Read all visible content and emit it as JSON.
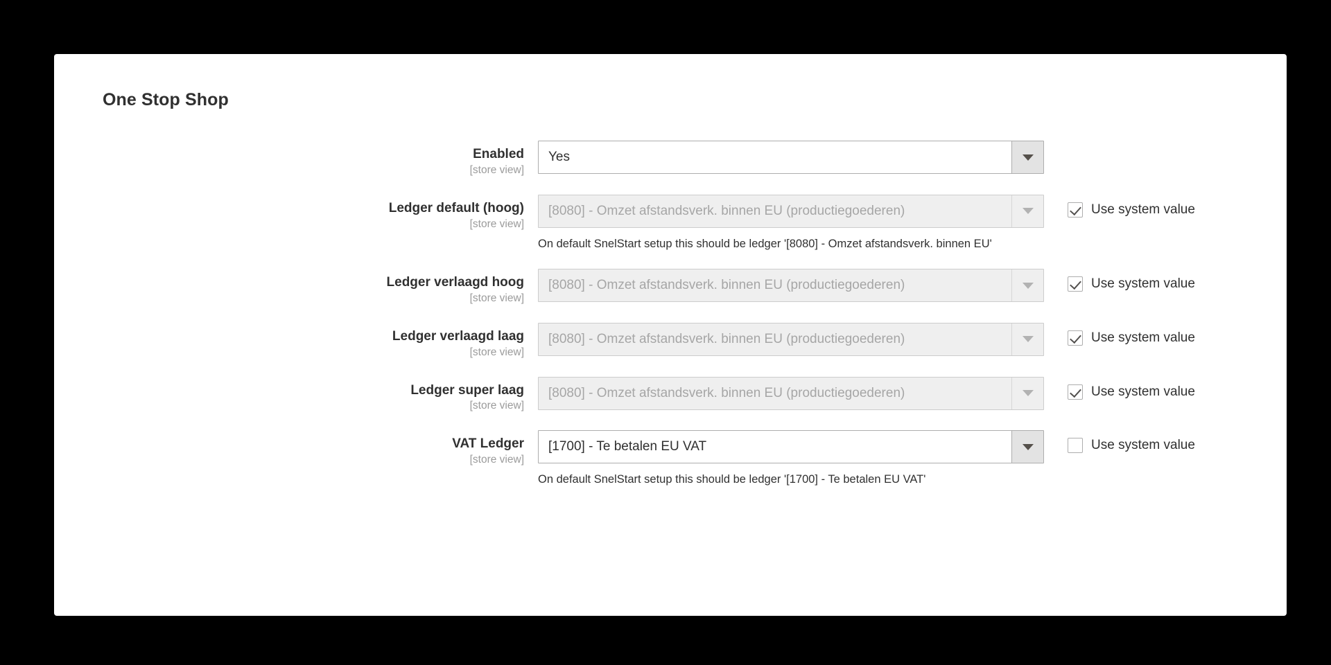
{
  "page": {
    "background_color": "#000000",
    "card_color": "#ffffff"
  },
  "section": {
    "title": "One Stop Shop"
  },
  "labels": {
    "scope": "[store view]",
    "use_system_value": "Use system value"
  },
  "fields": [
    {
      "name": "enabled",
      "label": "Enabled",
      "scope": "[store view]",
      "value": "Yes",
      "disabled": false,
      "use_system_value": null,
      "comment": ""
    },
    {
      "name": "ledger-default-hoog",
      "label": "Ledger default (hoog)",
      "scope": "[store view]",
      "value": "[8080] - Omzet afstandsverk. binnen EU (productiegoederen)",
      "disabled": true,
      "use_system_value": true,
      "comment": "On default SnelStart setup this should be ledger '[8080] - Omzet afstandsverk. binnen EU'"
    },
    {
      "name": "ledger-verlaagd-hoog",
      "label": "Ledger verlaagd hoog",
      "scope": "[store view]",
      "value": "[8080] - Omzet afstandsverk. binnen EU (productiegoederen)",
      "disabled": true,
      "use_system_value": true,
      "comment": ""
    },
    {
      "name": "ledger-verlaagd-laag",
      "label": "Ledger verlaagd laag",
      "scope": "[store view]",
      "value": "[8080] - Omzet afstandsverk. binnen EU (productiegoederen)",
      "disabled": true,
      "use_system_value": true,
      "comment": ""
    },
    {
      "name": "ledger-super-laag",
      "label": "Ledger super laag",
      "scope": "[store view]",
      "value": "[8080] - Omzet afstandsverk. binnen EU (productiegoederen)",
      "disabled": true,
      "use_system_value": true,
      "comment": ""
    },
    {
      "name": "vat-ledger",
      "label": "VAT Ledger",
      "scope": "[store view]",
      "value": "[1700] - Te betalen EU VAT",
      "disabled": false,
      "use_system_value": false,
      "comment": "On default SnelStart setup this should be ledger '[1700] - Te betalen EU VAT'"
    }
  ],
  "icons": {
    "dropdown": "chevron-down-icon",
    "checkmark": "check-icon"
  }
}
